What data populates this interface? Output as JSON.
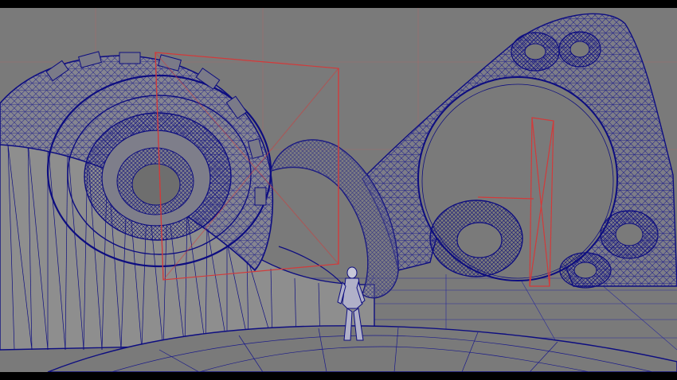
{
  "viewport": {
    "background": "#7a7a7a",
    "letterbox": "#000000",
    "wire": "#0d0d80",
    "wire_light": "#2a2aa0",
    "surface": "#8e8e8e",
    "surface_dark": "#6e6e6e",
    "guide": "#d23a3a"
  },
  "scene": {
    "objects": [
      {
        "kind": "gear-tunnel"
      },
      {
        "kind": "torus-arch"
      },
      {
        "kind": "pierced-arch"
      },
      {
        "kind": "small-torus"
      },
      {
        "kind": "character"
      },
      {
        "kind": "ground-dome"
      },
      {
        "kind": "ramp"
      }
    ]
  }
}
